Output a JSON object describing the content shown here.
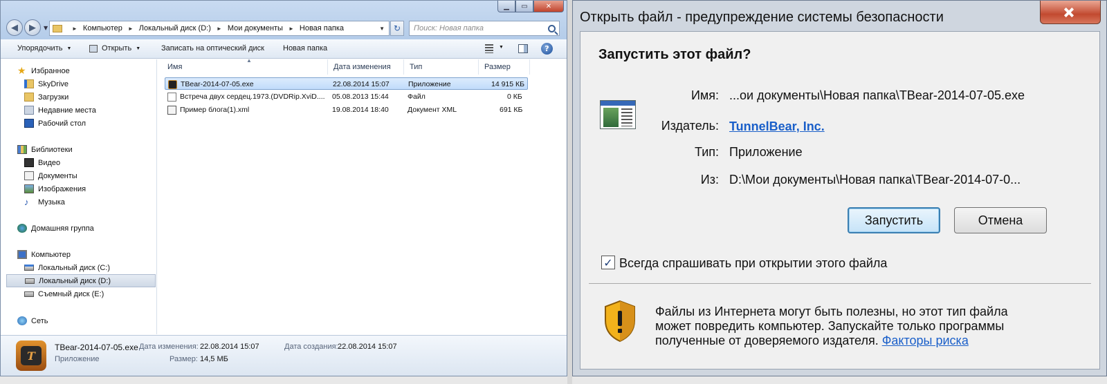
{
  "explorer": {
    "address": {
      "segments": [
        "Компьютер",
        "Локальный диск (D:)",
        "Мои документы",
        "Новая папка"
      ]
    },
    "search": {
      "placeholder": "Поиск: Новая папка"
    },
    "toolbar": {
      "organize": "Упорядочить",
      "open": "Открыть",
      "burn": "Записать на оптический диск",
      "new_folder": "Новая папка"
    },
    "nav": {
      "favorites": "Избранное",
      "skydrive": "SkyDrive",
      "downloads": "Загрузки",
      "recent": "Недавние места",
      "desktop": "Рабочий стол",
      "libraries": "Библиотеки",
      "video": "Видео",
      "documents": "Документы",
      "pictures": "Изображения",
      "music": "Музыка",
      "homegroup": "Домашняя группа",
      "computer": "Компьютер",
      "drive_c": "Локальный диск (C:)",
      "drive_d": "Локальный диск (D:)",
      "drive_e": "Съемный диск (E:)",
      "network": "Сеть"
    },
    "columns": {
      "name": "Имя",
      "date": "Дата изменения",
      "type": "Тип",
      "size": "Размер"
    },
    "files": [
      {
        "name": "TBear-2014-07-05.exe",
        "date": "22.08.2014 15:07",
        "type": "Приложение",
        "size": "14 915 КБ"
      },
      {
        "name": "Встреча двух сердец.1973.(DVDRip.XviD....",
        "date": "05.08.2013 15:44",
        "type": "Файл",
        "size": "0 КБ"
      },
      {
        "name": "Пример блога(1).xml",
        "date": "19.08.2014 18:40",
        "type": "Документ XML",
        "size": "691 КБ"
      }
    ],
    "details": {
      "filename": "TBear-2014-07-05.exe",
      "kind": "Приложение",
      "modified_label": "Дата изменения:",
      "modified": "22.08.2014 15:07",
      "size_label": "Размер:",
      "size": "14,5 МБ",
      "created_label": "Дата создания:",
      "created": "22.08.2014 15:07"
    }
  },
  "dialog": {
    "title": "Открыть файл - предупреждение системы безопасности",
    "heading": "Запустить этот файл?",
    "name_label": "Имя:",
    "name_value": "...ои документы\\Новая папка\\TBear-2014-07-05.exe",
    "publisher_label": "Издатель:",
    "publisher_value": "TunnelBear, Inc.",
    "type_label": "Тип:",
    "type_value": "Приложение",
    "from_label": "Из:",
    "from_value": "D:\\Мои документы\\Новая папка\\TBear-2014-07-0...",
    "run_button": "Запустить",
    "cancel_button": "Отмена",
    "checkbox_label": "Всегда спрашивать при открытии этого файла",
    "checkbox_checked": true,
    "warning_lines": [
      "Файлы из Интернета могут быть полезны, но этот тип файла",
      "может повредить компьютер. Запускайте только программы",
      "полученные от доверяемого издателя."
    ],
    "risk_link": "Факторы риска"
  }
}
